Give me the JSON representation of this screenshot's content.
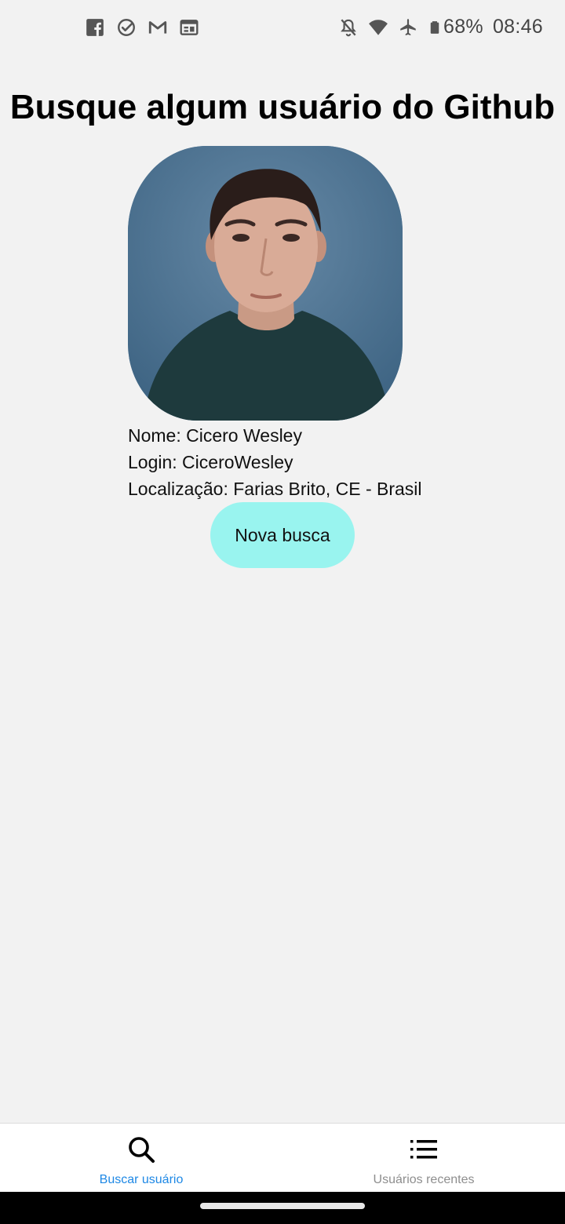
{
  "status_bar": {
    "left_icons": [
      "facebook-icon",
      "check-circle-icon",
      "gmail-icon",
      "calendar-icon"
    ],
    "right_icons": [
      "notifications-off-icon",
      "wifi-icon",
      "airplane-mode-icon",
      "battery-icon"
    ],
    "battery_percent": "68%",
    "time": "08:46"
  },
  "page": {
    "title": "Busque algum usuário do Github"
  },
  "profile": {
    "avatar_icon": "user-avatar-photo",
    "name_line": "Nome: Cicero Wesley",
    "login_line": "Login: CiceroWesley",
    "location_line": "Localização: Farias Brito, CE - Brasil"
  },
  "actions": {
    "new_search_label": "Nova busca",
    "new_search_color": "#99f4ef"
  },
  "bottom_nav": {
    "tabs": [
      {
        "label": "Buscar usuário",
        "icon": "search-icon",
        "active": true
      },
      {
        "label": "Usuários recentes",
        "icon": "list-icon",
        "active": false
      }
    ],
    "active_color": "#1e88e5",
    "inactive_color": "#8e8e8e"
  }
}
